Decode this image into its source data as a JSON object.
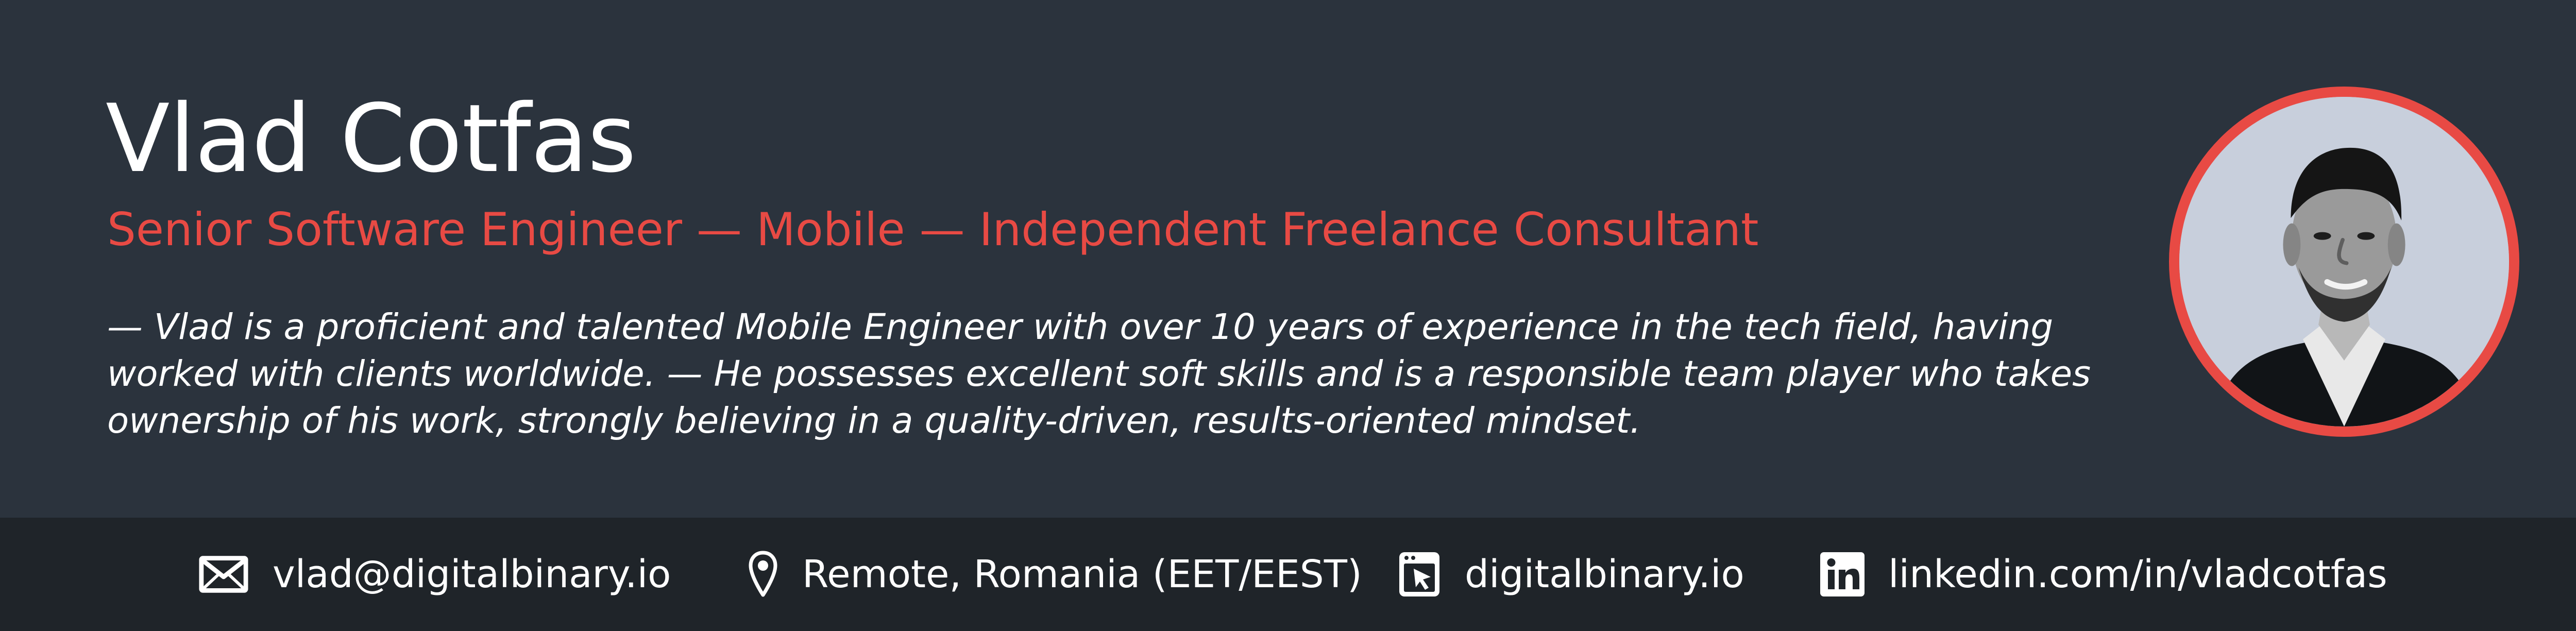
{
  "profile": {
    "name": "Vlad Cotfas",
    "subtitle": "Senior Software Engineer — Mobile — Independent Freelance Consultant",
    "bio_lines": [
      "— Vlad is a proficient and talented Mobile Engineer with over 10 years of experience in the tech field, having",
      "worked with clients worldwide. — He possesses excellent soft skills and is a responsible team player who takes",
      "ownership of his work, strongly believing in a quality-driven, results-oriented mindset."
    ]
  },
  "contacts": [
    {
      "icon": "mail-icon",
      "text": "vlad@digitalbinary.io"
    },
    {
      "icon": "location-pin-icon",
      "text": "Remote, Romania (EET/EEST)"
    },
    {
      "icon": "browser-cursor-icon",
      "text": "digitalbinary.io"
    },
    {
      "icon": "linkedin-icon",
      "text": "linkedin.com/in/vladcotfas"
    }
  ],
  "colors": {
    "background": "#2b333d",
    "footer": "#1f2429",
    "accent": "#e84a44",
    "text": "#ffffff",
    "avatar_background": "#c8cfdc"
  }
}
